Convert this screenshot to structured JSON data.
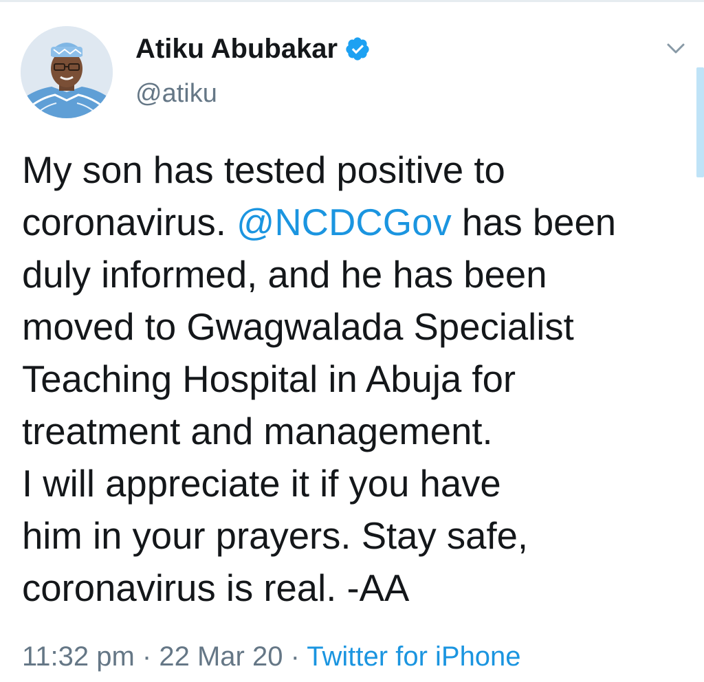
{
  "tweet": {
    "author": {
      "display_name": "Atiku Abubakar",
      "handle": "@atiku",
      "verified": true
    },
    "text_lines": [
      {
        "before": "My son has tested positive to",
        "mention": "",
        "after": ""
      },
      {
        "before": "coronavirus. ",
        "mention": "@NCDCGov",
        "after": " has been"
      },
      {
        "before": "duly informed, and he has been",
        "mention": "",
        "after": ""
      },
      {
        "before": "moved to Gwagwalada Specialist",
        "mention": "",
        "after": ""
      },
      {
        "before": "Teaching Hospital in Abuja for",
        "mention": "",
        "after": ""
      },
      {
        "before": "treatment and management.",
        "mention": "",
        "after": ""
      },
      {
        "before": "I will appreciate it if you have",
        "mention": "",
        "after": ""
      },
      {
        "before": "him in your prayers. Stay safe,",
        "mention": "",
        "after": ""
      },
      {
        "before": "coronavirus is real. -AA",
        "mention": "",
        "after": ""
      }
    ],
    "time": "11:32 pm",
    "separator": " · ",
    "date": "22 Mar 20",
    "source": "Twitter for iPhone"
  },
  "icons": {
    "verified": "verified-badge-icon",
    "menu": "chevron-down-icon"
  },
  "colors": {
    "link": "#1b95e0",
    "secondary_text": "#657786",
    "primary_text": "#14171a"
  }
}
